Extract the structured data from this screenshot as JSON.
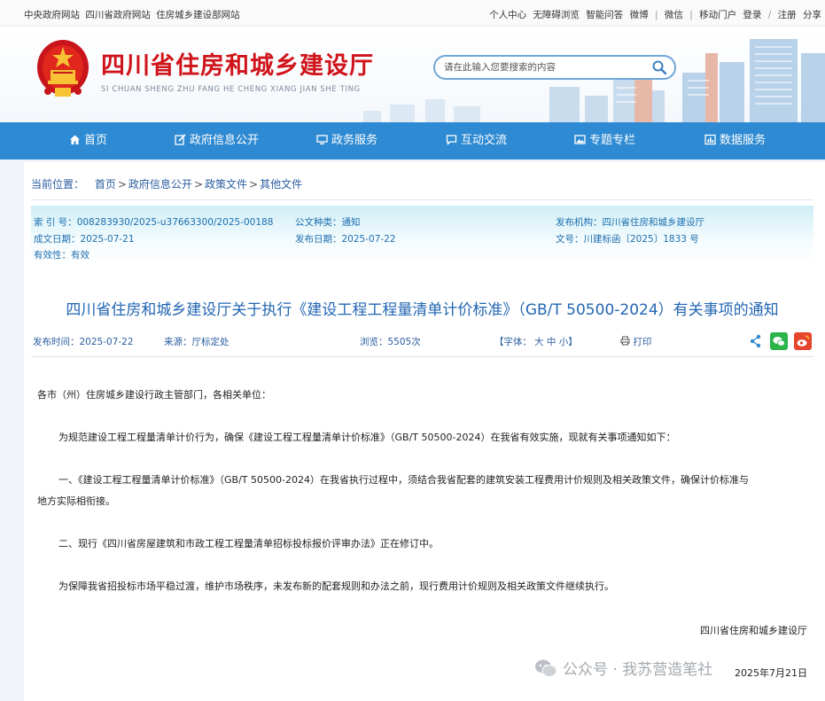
{
  "topbar": {
    "links_left": [
      "中央政府网站",
      "四川省政府网站",
      "住房城乡建设部网站"
    ],
    "links_right_a": [
      "个人中心",
      "无障碍浏览",
      "智能问答",
      "微博"
    ],
    "link_wechat": "微信",
    "link_mobile": "移动门户",
    "link_login": "登录",
    "link_register": "注册",
    "link_share": "分享"
  },
  "header": {
    "title": "四川省住房和城乡建设厅",
    "pinyin": "SI CHUAN SHENG ZHU FANG HE CHENG XIANG JIAN SHE TING",
    "search_placeholder": "请在此输入您要搜索的内容",
    "brand_red": "#d0141b",
    "nav_blue": "#2e8ad2"
  },
  "nav": [
    {
      "label": "首页",
      "icon": "home-icon"
    },
    {
      "label": "政府信息公开",
      "icon": "edit-icon"
    },
    {
      "label": "政务服务",
      "icon": "monitor-icon"
    },
    {
      "label": "互动交流",
      "icon": "chat-icon"
    },
    {
      "label": "专题专栏",
      "icon": "image-icon"
    },
    {
      "label": "数据服务",
      "icon": "chart-icon"
    }
  ],
  "breadcrumb": {
    "label": "当前位置：",
    "items": [
      "首页",
      "政府信息公开",
      "政策文件",
      "其他文件"
    ]
  },
  "meta": {
    "index_k": "索 引 号：",
    "index_v": "008283930/2025-u37663300/2025-00188",
    "type_k": "公文种类：",
    "type_v": "通知",
    "org_k": "发布机构：",
    "org_v": "四川省住房和城乡建设厅",
    "made_k": "成文日期：",
    "made_v": "2025-07-21",
    "pub_k": "发布日期：",
    "pub_v": "2025-07-22",
    "docno_k": "文号：",
    "docno_v": "川建标函〔2025〕1833 号",
    "valid_k": "有效性：",
    "valid_v": "有效"
  },
  "article": {
    "title": "四川省住房和城乡建设厅关于执行《建设工程工程量清单计价标准》（GB/T 50500-2024）有关事项的通知",
    "time_label": "发布时间：",
    "time": "2025-07-22",
    "source_label": "来源：",
    "source": "厅标定处",
    "views_label": "浏览：",
    "views": "5505次",
    "font_label": "【字体：",
    "font_large": "大",
    "font_medium": "中",
    "font_small": "小",
    "font_close": "】",
    "print": "打印",
    "paragraphs": [
      "各市（州）住房城乡建设行政主管部门，各相关单位：",
      "为规范建设工程工程量清单计价行为，确保《建设工程工程量清单计价标准》（GB/T 50500-2024）在我省有效实施，现就有关事项通知如下：",
      "一、《建设工程工程量清单计价标准》（GB/T 50500-2024）在我省执行过程中，须结合我省配套的建筑安装工程费用计价规则及相关政策文件，确保计价标准与",
      "地方实际相衔接。",
      "二、现行《四川省房屋建筑和市政工程工程量清单招标投标报价评审办法》正在修订中。",
      "为保障我省招投标市场平稳过渡，维护市场秩序，未发布新的配套规则和办法之前，现行费用计价规则及相关政策文件继续执行。"
    ],
    "signature": "四川省住房和城乡建设厅",
    "date": "2025年7月21日"
  },
  "watermark": "公众号 · 我苏营造笔社"
}
